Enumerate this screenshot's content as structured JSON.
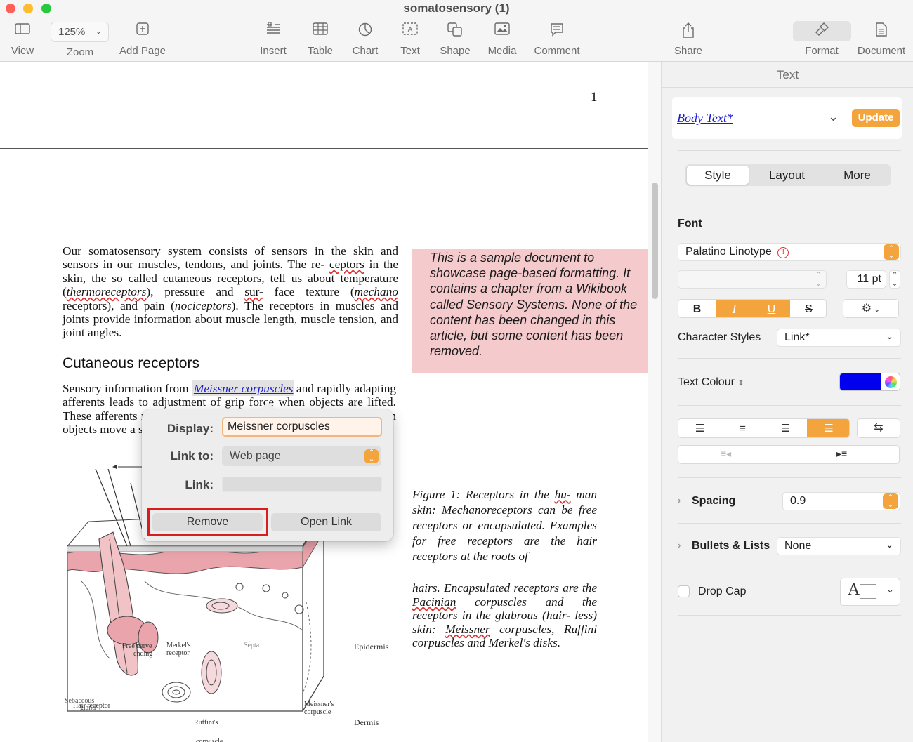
{
  "window": {
    "title": "somatosensory (1)"
  },
  "colors": {
    "accent": "#f3a43c",
    "link": "#1a1ad6",
    "highlight_box": "#f5cacd",
    "text_colour_swatch": "#0000ee",
    "remove_outline": "#d91c1c"
  },
  "toolbar": {
    "view": "View",
    "zoom_value": "125%",
    "zoom": "Zoom",
    "add_page": "Add Page",
    "insert": "Insert",
    "table": "Table",
    "chart": "Chart",
    "text": "Text",
    "shape": "Shape",
    "media": "Media",
    "comment": "Comment",
    "share": "Share",
    "format": "Format",
    "document": "Document"
  },
  "document": {
    "page_number": "1",
    "para1": {
      "a": "Our somatosensory system consists of sensors in the skin and sensors in our muscles, tendons, and joints. The re- ",
      "w1": "ceptors",
      "b": " in the skin, the so called cutaneous receptors, tell us about temperature (",
      "w2": "thermoreceptors",
      "c": "), pressure and ",
      "w3": "sur-",
      "d": " face texture (",
      "w4": "mechano",
      "e": " receptors), and pain (",
      "f": "nociceptors",
      "g": "). The receptors in muscles and joints provide information about muscle length, muscle tension, and joint angles."
    },
    "heading": "Cutaneous receptors",
    "para2": {
      "a": "Sensory information from ",
      "link": "Meissner corpuscles",
      "b": " and rapidly adapting afferents leads to adjustment of grip force when objects are lifted. These afferents respond with a brief burst of action potentials when objects move a small distance during the early stages of lifting."
    },
    "sidebox": "This is a sample document to showcase page-based formatting. It contains a chapter from a Wikibook called Sensory Systems. None of the content has been changed in this article, but some content has been removed.",
    "caption1": {
      "a": "Figure 1: Receptors in the ",
      "w": "hu-",
      "b": " man skin: Mechanoreceptors can be free receptors or encapsulated. Examples for free receptors are the hair receptors at the roots of"
    },
    "caption2": {
      "a": "hairs. Encapsulated receptors are the ",
      "w1": "Pacinian",
      "b": " corpuscles and the receptors in the glabrous (hair- less) skin: ",
      "w2": "Meissner",
      "c": " corpuscles, Ruffini corpuscles and Merkel's disks."
    },
    "figure_labels": {
      "epidermis": "Epidermis",
      "dermis": "Dermis",
      "free_nerve": "Free nerve",
      "ending": "ending",
      "merkels": "Merkel's",
      "receptor": "receptor",
      "septa": "Septa",
      "sebaceous": "Sebaceous",
      "gland": "gland",
      "meissners": "Meissner's",
      "corpuscle": "corpuscle",
      "ruffinis": "Ruffini's",
      "corpuscle2": "corpuscle",
      "hair_receptor": "Hair receptor"
    }
  },
  "link_popup": {
    "display_label": "Display:",
    "display_value": "Meissner corpuscles",
    "link_to_label": "Link to:",
    "link_to_value": "Web page",
    "link_label": "Link:",
    "link_value": "",
    "remove": "Remove",
    "open_link": "Open Link"
  },
  "sidebar": {
    "title": "Text",
    "paragraph_style": "Body Text*",
    "update": "Update",
    "tabs": [
      "Style",
      "Layout",
      "More"
    ],
    "font_section": "Font",
    "font_family": "Palatino Linotype",
    "font_warning_icon": "warning-circle-icon",
    "typeface": "",
    "font_size": "11 pt",
    "bold": "B",
    "italic": "I",
    "underline": "U",
    "strikethrough": "S",
    "character_styles_label": "Character Styles",
    "character_style_value": "Link*",
    "text_colour_label": "Text Colour",
    "spacing_label": "Spacing",
    "spacing_value": "0.9",
    "bullets_label": "Bullets & Lists",
    "bullets_value": "None",
    "drop_cap_label": "Drop Cap",
    "drop_cap_preview": "A"
  }
}
